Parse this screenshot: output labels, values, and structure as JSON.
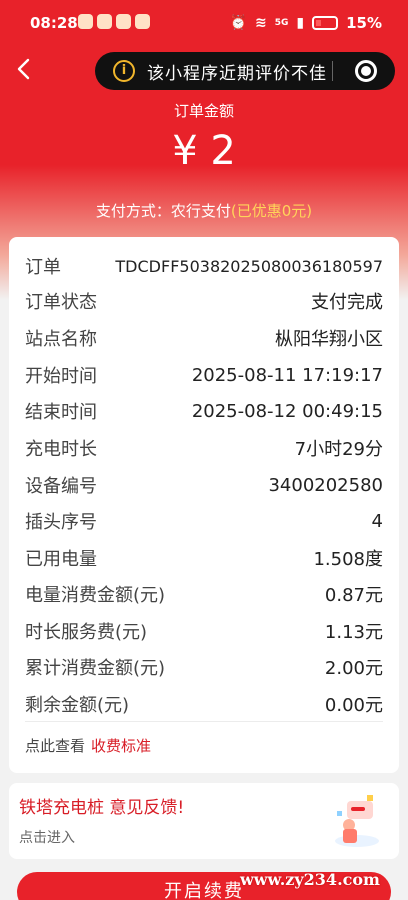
{
  "status_bar": {
    "time": "08:28",
    "signal_label": "5G",
    "battery_percent": "15%"
  },
  "header": {
    "notice_text": "该小程序近期评价不佳",
    "notice_icon": "info-icon"
  },
  "summary": {
    "amount_label": "订单金额",
    "amount_value": "¥ 2",
    "pay_method_prefix": "支付方式：农行支付",
    "pay_method_discount": "(已优惠0元)"
  },
  "details": [
    {
      "label": "订单",
      "value": "TDCDFF50382025080036180597"
    },
    {
      "label": "订单状态",
      "value": "支付完成"
    },
    {
      "label": "站点名称",
      "value": "枞阳华翔小区"
    },
    {
      "label": "开始时间",
      "value": "2025-08-11 17:19:17"
    },
    {
      "label": "结束时间",
      "value": "2025-08-12 00:49:15"
    },
    {
      "label": "充电时长",
      "value": "7小时29分"
    },
    {
      "label": "设备编号",
      "value": "3400202580"
    },
    {
      "label": "插头序号",
      "value": "4"
    },
    {
      "label": "已用电量",
      "value": "1.508度"
    },
    {
      "label": "电量消费金额(元)",
      "value": "0.87元"
    },
    {
      "label": "时长服务费(元)",
      "value": "1.13元"
    },
    {
      "label": "累计消费金额(元)",
      "value": "2.00元"
    },
    {
      "label": "剩余金额(元)",
      "value": "0.00元"
    }
  ],
  "fee_link": {
    "prefix": "点此查看",
    "link": "收费标准"
  },
  "feedback": {
    "title": "铁塔充电桩 意见反馈!",
    "subtitle": "点击进入"
  },
  "cta": {
    "label": "开启续费"
  },
  "watermark": "www.zy234.com",
  "colors": {
    "brand_red": "#e8222a",
    "discount_yellow": "#ffd45a"
  }
}
